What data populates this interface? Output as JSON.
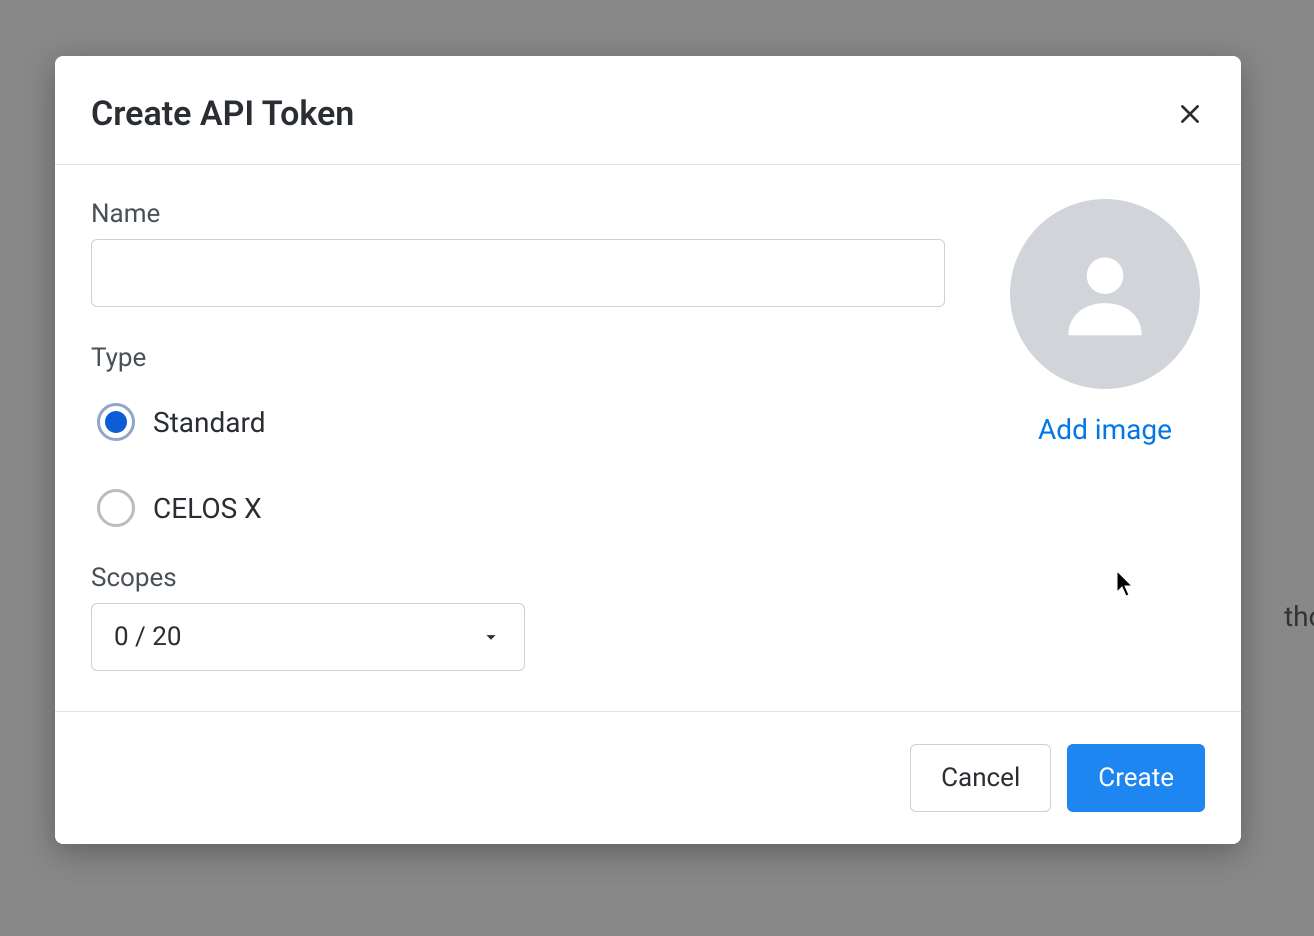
{
  "background": {
    "partial_text": "thor"
  },
  "modal": {
    "title": "Create API Token",
    "form": {
      "name": {
        "label": "Name",
        "value": ""
      },
      "type": {
        "label": "Type",
        "options": [
          {
            "label": "Standard",
            "selected": true
          },
          {
            "label": "CELOS X",
            "selected": false
          }
        ]
      },
      "scopes": {
        "label": "Scopes",
        "value": "0 / 20"
      }
    },
    "image": {
      "add_link": "Add image"
    },
    "footer": {
      "cancel": "Cancel",
      "create": "Create"
    }
  }
}
